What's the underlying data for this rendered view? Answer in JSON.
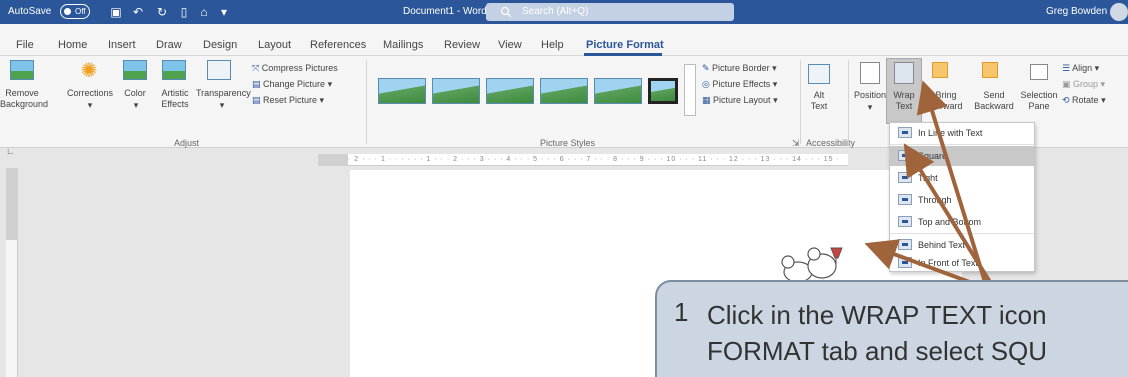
{
  "titlebar": {
    "autosave_label": "AutoSave",
    "autosave_state": "Off",
    "doc_name": "Document1  -  Word",
    "search_placeholder": "Search (Alt+Q)",
    "user_name": "Greg Bowden"
  },
  "menu": {
    "items": [
      "File",
      "Home",
      "Insert",
      "Draw",
      "Design",
      "Layout",
      "References",
      "Mailings",
      "Review",
      "View",
      "Help",
      "Picture Format"
    ],
    "active": "Picture Format"
  },
  "ribbon": {
    "remove_background": [
      "Remove",
      "Background"
    ],
    "corrections": "Corrections",
    "color": "Color",
    "artistic_effects": [
      "Artistic",
      "Effects"
    ],
    "transparency": "Transparency",
    "compress_pictures": "Compress Pictures",
    "change_picture": "Change Picture",
    "reset_picture": "Reset Picture",
    "group_adjust": "Adjust",
    "group_picture_styles": "Picture Styles",
    "picture_border": "Picture Border",
    "picture_effects": "Picture Effects",
    "picture_layout": "Picture Layout",
    "alt_text": [
      "Alt",
      "Text"
    ],
    "group_accessibility": "Accessibility",
    "position": "Position",
    "wrap_text": [
      "Wrap",
      "Text"
    ],
    "bring_forward": [
      "Bring",
      "Forward"
    ],
    "send_backward": [
      "Send",
      "Backward"
    ],
    "selection_pane": [
      "Selection",
      "Pane"
    ],
    "align": "Align",
    "group": "Group",
    "rotate": "Rotate"
  },
  "ruler": {
    "marks": "· 2 · · · 1 · · ·   · · · 1 · · · 2 · · · 3 · · · 4 · · · 5 · · · 6 · · · 7 · · · 8 · · · 9 · · · 10 · · · 11 · · · 12 · · · 13 · · · 14 · · · 15 ·"
  },
  "wrap_menu": {
    "items": [
      {
        "label": "In Line with Text"
      },
      {
        "label": "Square"
      },
      {
        "label": "Tight"
      },
      {
        "label": "Through"
      },
      {
        "label": "Top and Bottom"
      },
      {
        "label": "Behind Text"
      },
      {
        "label": "In Front of Text"
      }
    ],
    "selected": "Square"
  },
  "callout": {
    "number": "1",
    "line1": "Click in the WRAP TEXT icon",
    "line2": "FORMAT tab and select SQU"
  },
  "colors": {
    "word_blue": "#2b579a",
    "arrow": "#a0643c",
    "callout_bg": "#ccd6e2"
  }
}
